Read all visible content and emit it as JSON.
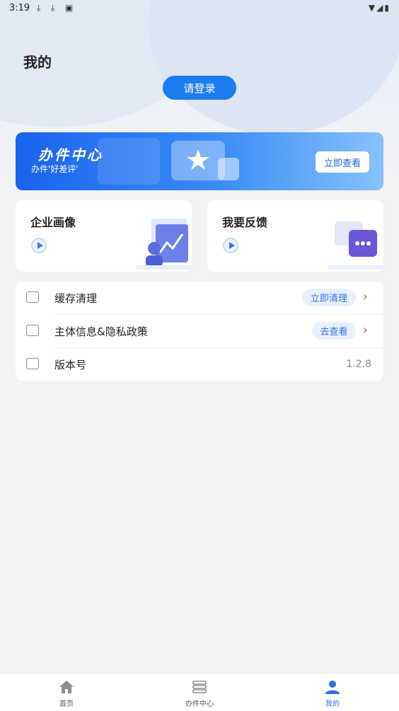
{
  "status_bar": {
    "time": "3:19"
  },
  "header": {
    "title": "我的",
    "login_label": "请登录"
  },
  "banner": {
    "title": "办件中心",
    "subtitle": "办件'好差评'",
    "button_label": "立即查看"
  },
  "cards": [
    {
      "title": "企业画像"
    },
    {
      "title": "我要反馈"
    }
  ],
  "menu": [
    {
      "label": "缓存清理",
      "action_label": "立即清理"
    },
    {
      "label": "主体信息&隐私政策",
      "action_label": "去查看"
    },
    {
      "label": "版本号",
      "value": "1.2.8"
    }
  ],
  "tabbar": [
    {
      "label": "首页",
      "active": false
    },
    {
      "label": "办件中心",
      "active": false
    },
    {
      "label": "我的",
      "active": true
    }
  ],
  "colors": {
    "accent": "#1b7cf0",
    "active_tab": "#2f6fe0"
  }
}
